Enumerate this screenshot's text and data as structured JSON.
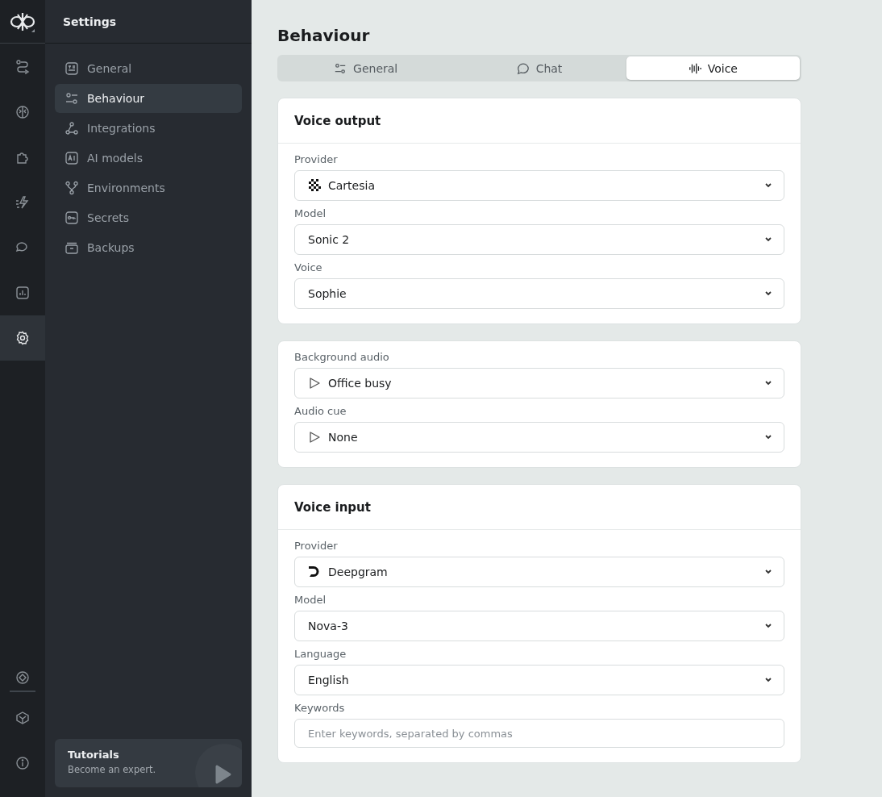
{
  "rail": {
    "top": [
      {
        "selected": false
      },
      {
        "selected": false
      },
      {
        "selected": false
      },
      {
        "selected": false
      },
      {
        "selected": false
      },
      {
        "selected": false
      },
      {
        "selected": true
      }
    ]
  },
  "sidebar": {
    "title": "Settings",
    "items": [
      {
        "label": "General",
        "selected": false
      },
      {
        "label": "Behaviour",
        "selected": true
      },
      {
        "label": "Integrations",
        "selected": false
      },
      {
        "label": "AI models",
        "selected": false
      },
      {
        "label": "Environments",
        "selected": false
      },
      {
        "label": "Secrets",
        "selected": false
      },
      {
        "label": "Backups",
        "selected": false
      }
    ],
    "tutorial": {
      "title": "Tutorials",
      "subtitle": "Become an expert."
    }
  },
  "page": {
    "title": "Behaviour",
    "tabs": [
      {
        "label": "General",
        "selected": false
      },
      {
        "label": "Chat",
        "selected": false
      },
      {
        "label": "Voice",
        "selected": true
      }
    ],
    "cards": [
      {
        "title": "Voice output",
        "fields": [
          {
            "label": "Provider",
            "kind": "checker",
            "value": "Cartesia"
          },
          {
            "label": "Model",
            "kind": "select",
            "value": "Sonic 2"
          },
          {
            "label": "Voice",
            "kind": "select",
            "value": "Sophie"
          }
        ]
      },
      {
        "fields": [
          {
            "label": "Background audio",
            "kind": "play",
            "value": "Office busy"
          },
          {
            "label": "Audio cue",
            "kind": "play",
            "value": "None"
          }
        ]
      },
      {
        "title": "Voice input",
        "fields": [
          {
            "label": "Provider",
            "kind": "dlogo",
            "value": "Deepgram"
          },
          {
            "label": "Model",
            "kind": "select",
            "value": "Nova-3"
          },
          {
            "label": "Language",
            "kind": "select",
            "value": "English"
          },
          {
            "label": "Keywords",
            "kind": "text",
            "placeholder": "Enter keywords, separated by commas"
          }
        ]
      }
    ]
  }
}
